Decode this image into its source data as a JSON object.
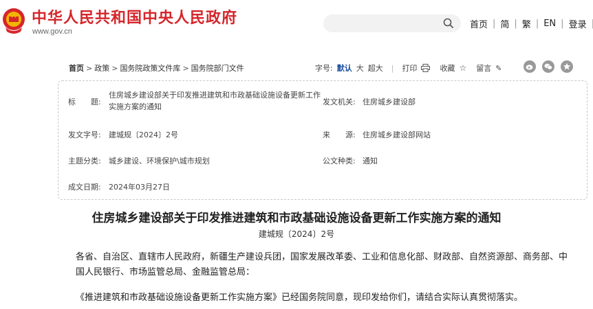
{
  "header": {
    "site_title": "中华人民共和国中央人民政府",
    "site_url": "www.gov.cn",
    "emblem_icon": "national-emblem-icon",
    "search_icon": "search-icon",
    "nav": [
      "首页",
      "简",
      "繁",
      "EN",
      "登录",
      "|"
    ]
  },
  "breadcrumb": [
    "首页",
    "政策",
    "国务院政策文件库",
    "国务院部门文件"
  ],
  "toolbar": {
    "font_size_label": "字号:",
    "sizes": [
      "默认",
      "大",
      "超大"
    ],
    "active_size": "默认",
    "print_label": "打印",
    "favorite_label": "收藏",
    "comment_label": "留言",
    "share_icons": [
      "weibo-icon",
      "wechat-icon",
      "star-share-icon"
    ]
  },
  "meta": {
    "title_label": "标　　题:",
    "title_value": "住房城乡建设部关于印发推进建筑和市政基础设施设备更新工作实施方案的通知",
    "issuer_label": "发文机关:",
    "issuer_value": "住房城乡建设部",
    "doc_no_label": "发文字号:",
    "doc_no_value": "建城规〔2024〕2号",
    "source_label": "来　　源:",
    "source_value": "住房城乡建设部网站",
    "category_label": "主题分类:",
    "category_value": "城乡建设、环境保护\\城市规划",
    "type_label": "公文种类:",
    "type_value": "通知",
    "date_label": "成文日期:",
    "date_value": "2024年03月27日"
  },
  "article": {
    "title": "住房城乡建设部关于印发推进建筑和市政基础设施设备更新工作实施方案的通知",
    "doc_number": "建城规〔2024〕2号",
    "para1": "各省、自治区、直辖市人民政府，新疆生产建设兵团，国家发展改革委、工业和信息化部、财政部、自然资源部、商务部、中国人民银行、市场监管总局、金融监管总局：",
    "para2": "《推进建筑和市政基础设施设备更新工作实施方案》已经国务院同意，现印发给你们，请结合实际认真贯彻落实。"
  }
}
